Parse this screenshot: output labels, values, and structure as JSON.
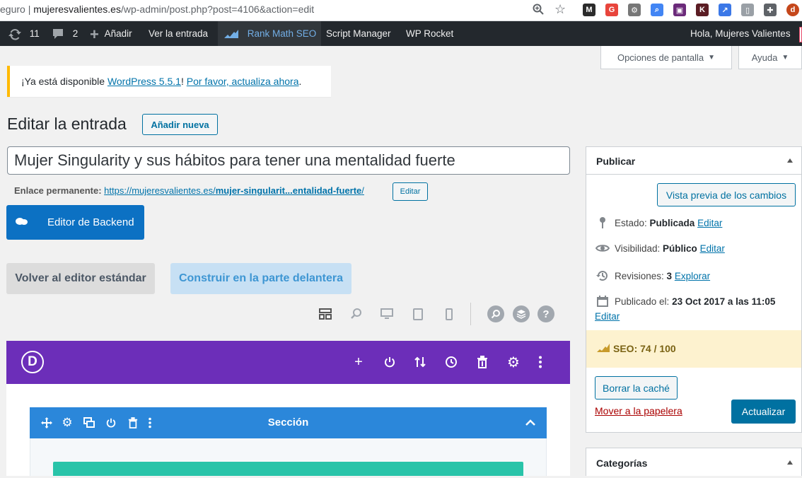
{
  "browser": {
    "url_prefix": "eguro",
    "url_domain": "mujeresvalientes.es",
    "url_path": "/wp-admin/post.php?post=4106&action=edit",
    "extension_icons": [
      {
        "name": "gmail-m",
        "color": "#2b2b2b",
        "glyph": "M"
      },
      {
        "name": "translate",
        "color": "#e8453c",
        "glyph": "G"
      },
      {
        "name": "gear",
        "color": "#777777",
        "glyph": "⚙"
      },
      {
        "name": "search-ext",
        "color": "#4285f4",
        "glyph": "⌕"
      },
      {
        "name": "calendar-ext",
        "color": "#6b2a7a",
        "glyph": "▣"
      },
      {
        "name": "k-ext",
        "color": "#5b1d24",
        "glyph": "K"
      },
      {
        "name": "chart-ext",
        "color": "#3b78e7",
        "glyph": "↗"
      },
      {
        "name": "person-ext",
        "color": "#9aa0a6",
        "glyph": "▯"
      },
      {
        "name": "puzzle",
        "color": "#5f6368",
        "glyph": "✚"
      },
      {
        "name": "profile",
        "color": "#c5471b",
        "glyph": "d"
      }
    ]
  },
  "admin_bar": {
    "updates_count": "11",
    "comments_count": "2",
    "add_new": "Añadir",
    "view_post": "Ver la entrada",
    "rank_math": "Rank Math SEO",
    "script_manager": "Script Manager",
    "wp_rocket": "WP Rocket",
    "greeting": "Hola, Mujeres Valientes"
  },
  "screen_tabs": {
    "screen_options": "Opciones de pantalla",
    "help": "Ayuda"
  },
  "notice": {
    "prefix": "¡Ya está disponible ",
    "version_link": "WordPress 5.5.1",
    "middle": "! ",
    "update_link": "Por favor, actualiza ahora",
    "suffix": "."
  },
  "page": {
    "title": "Editar la entrada",
    "add_new_button": "Añadir nueva"
  },
  "post": {
    "title": "Mujer Singularity y sus hábitos para tener una mentalidad fuerte",
    "permalink_label": "Enlace permanente:",
    "permalink_base": "https://mujeresvalientes.es/",
    "permalink_slug": "mujer-singularit...entalidad-fuerte",
    "permalink_end": "/",
    "permalink_edit": "Editar"
  },
  "builder": {
    "backend_button": "Editor de Backend",
    "standard_editor": "Volver al editor estándar",
    "frontend_builder": "Construir en la parte delantera",
    "logo_letter": "D",
    "section_title": "Sección"
  },
  "publish": {
    "title": "Publicar",
    "preview_button": "Vista previa de los cambios",
    "status_label": "Estado: ",
    "status_value": "Publicada",
    "status_edit": "Editar",
    "visibility_label": "Visibilidad: ",
    "visibility_value": "Público",
    "visibility_edit": "Editar",
    "revisions_label": "Revisiones: ",
    "revisions_value": "3",
    "revisions_link": "Explorar",
    "published_label": "Publicado el: ",
    "published_value": "23 Oct 2017 a las 11:05",
    "published_edit": "Editar",
    "seo_text": "SEO: 74 / 100",
    "clear_cache": "Borrar la caché",
    "trash": "Mover a la papelera",
    "update_button": "Actualizar"
  },
  "categories": {
    "title": "Categorías"
  },
  "colors": {
    "admin_bar": "#23282d",
    "wp_blue": "#0071a1",
    "divi_purple": "#6c2eb9",
    "divi_section_blue": "#2b87da",
    "divi_row_teal": "#29c4a9",
    "notice_yellow": "#ffb900"
  }
}
